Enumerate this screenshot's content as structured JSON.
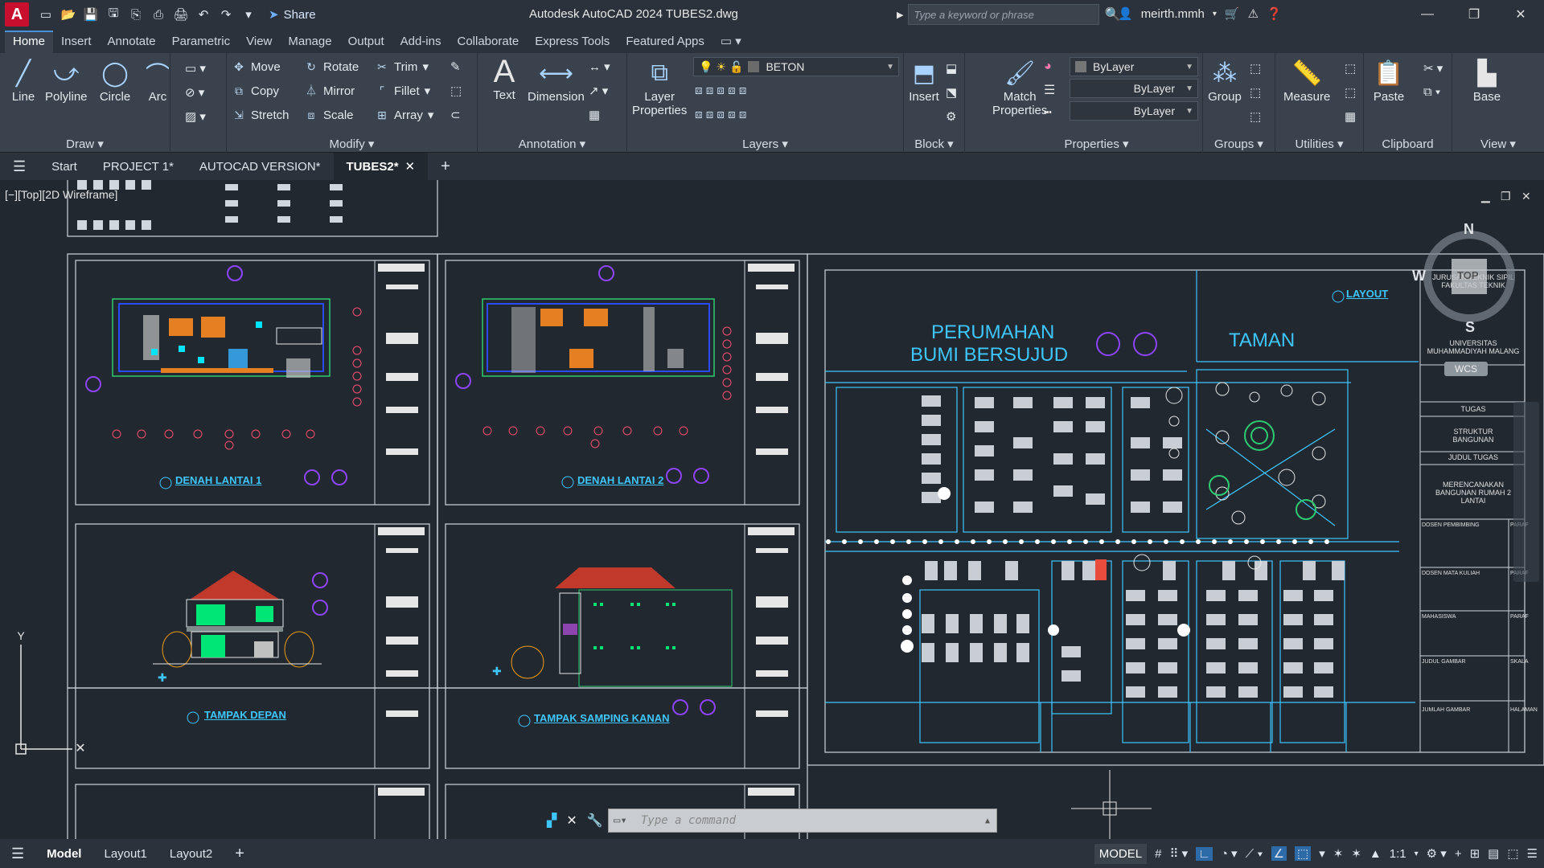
{
  "titlebar": {
    "logo": "A",
    "share": "Share",
    "title": "Autodesk AutoCAD 2024    TUBES2.dwg",
    "search_placeholder": "Type a keyword or phrase",
    "user": "meirth.mmh"
  },
  "ribbon_tabs": [
    "Home",
    "Insert",
    "Annotate",
    "Parametric",
    "View",
    "Manage",
    "Output",
    "Add-ins",
    "Collaborate",
    "Express Tools",
    "Featured Apps"
  ],
  "ribbon": {
    "draw": {
      "label": "Draw",
      "line": "Line",
      "polyline": "Polyline",
      "circle": "Circle",
      "arc": "Arc"
    },
    "modify": {
      "label": "Modify",
      "move": "Move",
      "rotate": "Rotate",
      "trim": "Trim",
      "copy": "Copy",
      "mirror": "Mirror",
      "fillet": "Fillet",
      "stretch": "Stretch",
      "scale": "Scale",
      "array": "Array"
    },
    "annotation": {
      "label": "Annotation",
      "text": "Text",
      "dimension": "Dimension"
    },
    "layers": {
      "label": "Layers",
      "layer_properties_1": "Layer",
      "layer_properties_2": "Properties",
      "current_layer": "BETON"
    },
    "block": {
      "label": "Block",
      "insert": "Insert"
    },
    "properties": {
      "label": "Properties",
      "match_1": "Match",
      "match_2": "Properties",
      "color": "ByLayer",
      "linetype": "ByLayer",
      "lineweight": "ByLayer"
    },
    "groups": {
      "label": "Groups",
      "group": "Group"
    },
    "utilities": {
      "label": "Utilities",
      "measure": "Measure"
    },
    "clipboard": {
      "label": "Clipboard",
      "paste": "Paste"
    },
    "view": {
      "label": "View",
      "base": "Base"
    }
  },
  "doctabs": [
    "Start",
    "PROJECT 1*",
    "AUTOCAD VERSION*",
    "TUBES2*"
  ],
  "viewport": {
    "label": "[−][Top][2D Wireframe]",
    "drawings": {
      "denah1": "DENAH LANTAI 1",
      "denah2": "DENAH LANTAI 2",
      "depan": "TAMPAK DEPAN",
      "samping": "TAMPAK SAMPING KANAN",
      "layout": "LAYOUT",
      "perumahan_1": "PERUMAHAN",
      "perumahan_2": "BUMI BERSUJUD",
      "taman": "TAMAN"
    },
    "titleblock": {
      "univ_1": "JURUSAN TEKNIK SIPIL",
      "univ_2": "FAKULTAS TEKNIK",
      "univ_3": "UNIVERSITAS",
      "univ_4": "MUHAMMADIYAH MALANG",
      "tugas": "TUGAS",
      "tugas_val_1": "STRUKTUR",
      "tugas_val_2": "BANGUNAN",
      "judul": "JUDUL TUGAS",
      "judul_val_1": "MERENCANAKAN",
      "judul_val_2": "BANGUNAN RUMAH 2",
      "judul_val_3": "LANTAI",
      "dosen_pemb": "DOSEN PEMBIMBING",
      "dosen_mk": "DOSEN MATA KULIAH",
      "mahasiswa": "MAHASISWA",
      "paraf": "PARAF",
      "judul_gambar": "JUDUL GAMBAR",
      "skala": "SKALA",
      "jumlah_gambar": "JUMLAH GAMBAR",
      "halaman": "HALAMAN"
    },
    "navcube": {
      "n": "N",
      "s": "S",
      "w": "W",
      "face": "TOP",
      "wcs": "WCS"
    }
  },
  "command": {
    "placeholder": "Type a command"
  },
  "statusbar": {
    "tabs": [
      "Model",
      "Layout1",
      "Layout2"
    ],
    "model_btn": "MODEL",
    "scale": "1:1"
  }
}
